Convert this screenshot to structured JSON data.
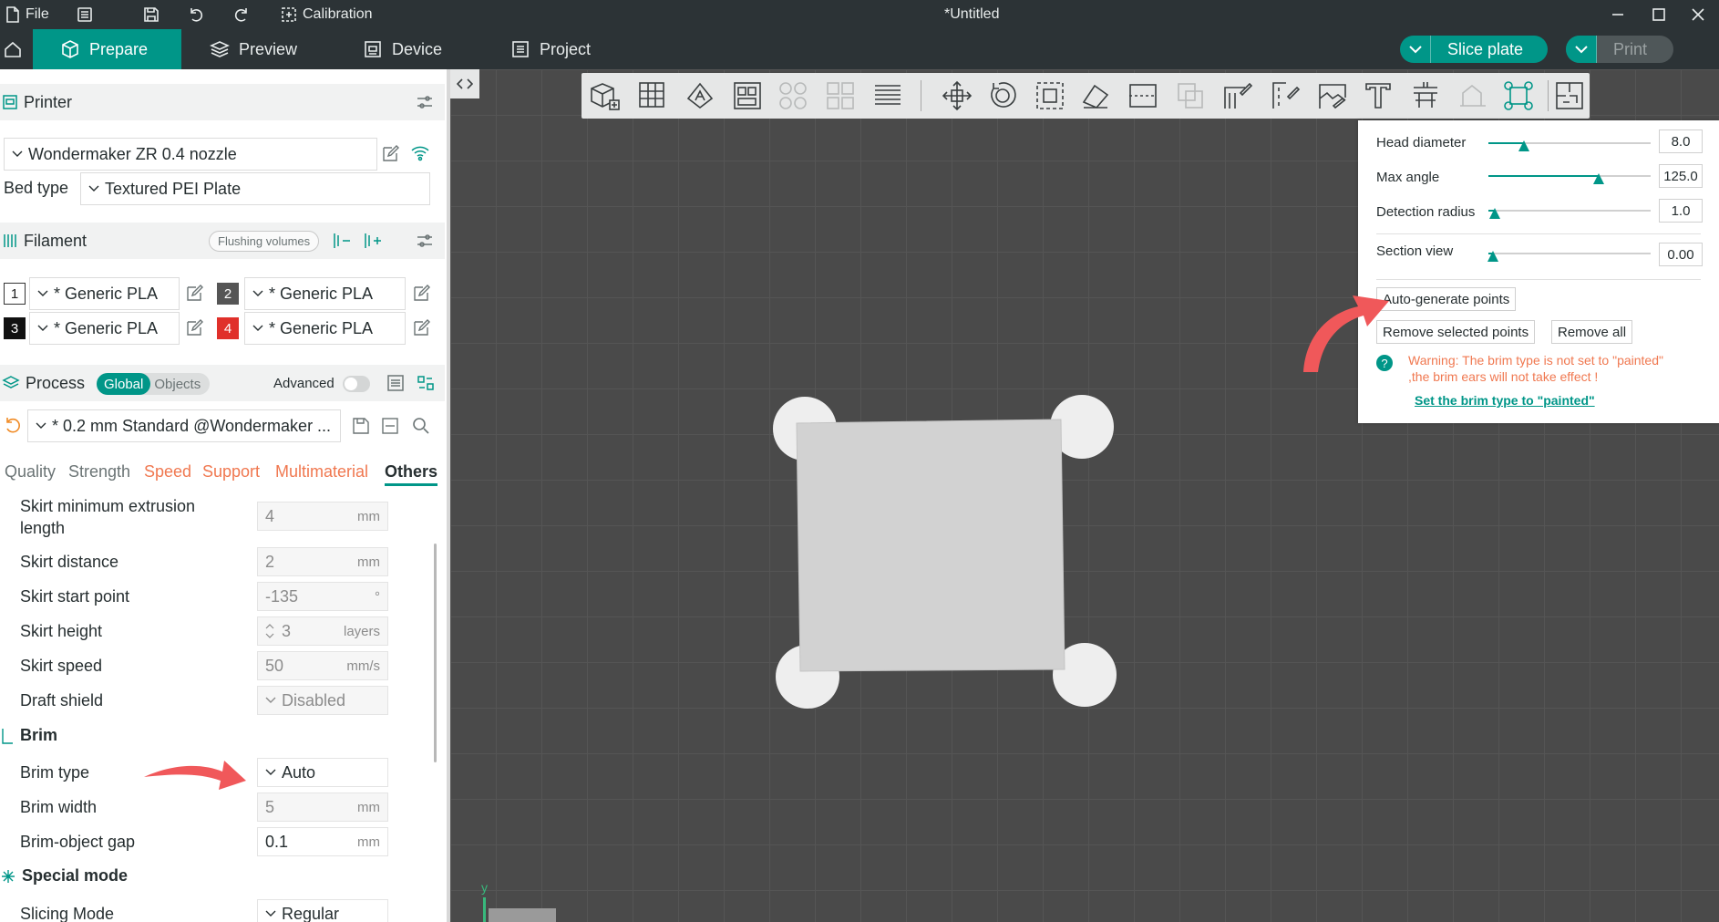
{
  "titlebar": {
    "file_label": "File",
    "calibration_label": "Calibration",
    "window_title": "*Untitled"
  },
  "mainnav": {
    "tabs": [
      {
        "label": "Prepare"
      },
      {
        "label": "Preview"
      },
      {
        "label": "Device"
      },
      {
        "label": "Project"
      }
    ],
    "slice_label": "Slice plate",
    "print_label": "Print"
  },
  "printer": {
    "section_label": "Printer",
    "selected": "Wondermaker ZR 0.4 nozzle",
    "bed_type_label": "Bed type",
    "bed_type_value": "Textured PEI Plate"
  },
  "filament": {
    "section_label": "Filament",
    "flushing_label": "Flushing volumes",
    "slots": [
      {
        "num": "1",
        "name": "* Generic PLA",
        "color": "#ffffff"
      },
      {
        "num": "2",
        "name": "* Generic PLA",
        "color": "#555555"
      },
      {
        "num": "3",
        "name": "* Generic PLA",
        "color": "#111111"
      },
      {
        "num": "4",
        "name": "* Generic PLA",
        "color": "#e0302a"
      }
    ]
  },
  "process": {
    "section_label": "Process",
    "global_label": "Global",
    "objects_label": "Objects",
    "advanced_label": "Advanced",
    "preset": "* 0.2 mm  Standard @Wondermaker ...",
    "tabs": [
      "Quality",
      "Strength",
      "Speed",
      "Support",
      "Multimaterial",
      "Others"
    ],
    "active_tab": "Others",
    "skirt": {
      "min_extrusion_label_1": "Skirt minimum extrusion",
      "min_extrusion_label_2": "length",
      "min_extrusion_value": "4",
      "distance_label": "Skirt distance",
      "distance_value": "2",
      "start_point_label": "Skirt start point",
      "start_point_value": "-135",
      "height_label": "Skirt height",
      "height_value": "3",
      "speed_label": "Skirt speed",
      "speed_value": "50",
      "draft_label": "Draft shield",
      "draft_value": "Disabled"
    },
    "brim": {
      "group_label": "Brim",
      "type_label": "Brim type",
      "type_value": "Auto",
      "width_label": "Brim width",
      "width_value": "5",
      "gap_label": "Brim-object gap",
      "gap_value": "0.1"
    },
    "special": {
      "group_label": "Special mode",
      "slicing_label": "Slicing Mode",
      "slicing_value": "Regular"
    },
    "units": {
      "mm": "mm",
      "deg": "°",
      "layers": "layers",
      "mms": "mm/s"
    }
  },
  "supports_panel": {
    "head_diameter_label": "Head diameter",
    "head_diameter_value": "8.0",
    "head_diameter_level": 0.22,
    "max_angle_label": "Max angle",
    "max_angle_value": "125.0",
    "max_angle_level": 0.68,
    "detection_radius_label": "Detection radius",
    "detection_radius_value": "1.0",
    "detection_radius_level": 0.04,
    "section_view_label": "Section view",
    "section_view_value": "0.00",
    "section_view_level": 0.03,
    "auto_generate_label": "Auto-generate points",
    "remove_selected_label": "Remove selected points",
    "remove_all_label": "Remove all",
    "warning_line_1": "Warning: The brim type is not set to \"painted\"",
    "warning_line_2": ",the brim ears will not take effect !",
    "set_brim_link": "Set the brim type to \"painted\""
  },
  "viewport": {
    "axis_y_label": "y"
  },
  "colors": {
    "accent": "#009688",
    "warning": "#f07850",
    "arrow": "#f0585a",
    "bed": "#4a4a4a",
    "object": "#d2d2d2",
    "brim_ear": "#eeeeee"
  }
}
